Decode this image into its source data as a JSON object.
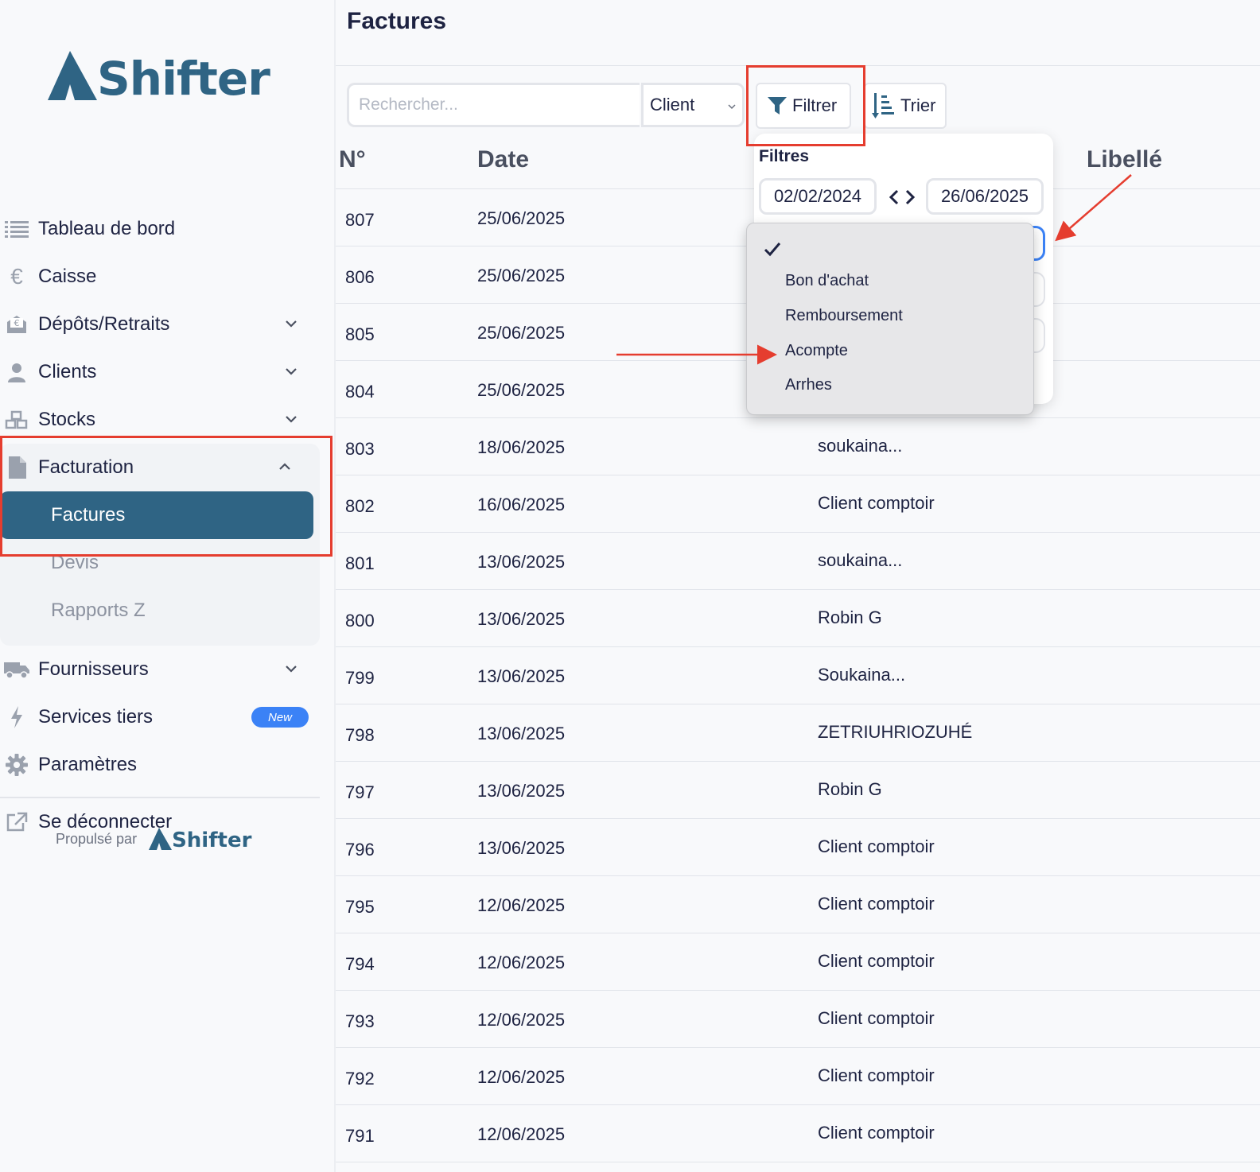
{
  "sidebar": {
    "logo_text": "Shifter",
    "items": [
      {
        "label": "Tableau de bord",
        "icon": "list-icon"
      },
      {
        "label": "Caisse",
        "icon": "euro-icon"
      },
      {
        "label": "Dépôts/Retraits",
        "icon": "envelope-euro-icon"
      },
      {
        "label": "Clients",
        "icon": "user-icon"
      },
      {
        "label": "Stocks",
        "icon": "boxes-icon"
      },
      {
        "label": "Facturation",
        "icon": "file-icon"
      },
      {
        "label": "Fournisseurs",
        "icon": "truck-icon"
      },
      {
        "label": "Services tiers",
        "icon": "bolt-icon",
        "badge": "New"
      },
      {
        "label": "Paramètres",
        "icon": "gear-icon"
      }
    ],
    "sub_items": [
      "Factures",
      "Devis",
      "Rapports Z"
    ],
    "logout_label": "Se déconnecter",
    "powered_by": "Propulsé par",
    "powered_logo": "Shifter"
  },
  "main": {
    "title": "Factures",
    "search_placeholder": "Rechercher...",
    "client_select": "Client",
    "filter_label": "Filtrer",
    "sort_label": "Trier",
    "columns": [
      "N°",
      "Date",
      "Libellé"
    ],
    "rows": [
      {
        "no": "807",
        "date": "25/06/2025",
        "client": ""
      },
      {
        "no": "806",
        "date": "25/06/2025",
        "client": ""
      },
      {
        "no": "805",
        "date": "25/06/2025",
        "client": ""
      },
      {
        "no": "804",
        "date": "25/06/2025",
        "client": ""
      },
      {
        "no": "803",
        "date": "18/06/2025",
        "client": "soukaina..."
      },
      {
        "no": "802",
        "date": "16/06/2025",
        "client": "Client comptoir"
      },
      {
        "no": "801",
        "date": "13/06/2025",
        "client": "soukaina..."
      },
      {
        "no": "800",
        "date": "13/06/2025",
        "client": "Robin G"
      },
      {
        "no": "799",
        "date": "13/06/2025",
        "client": "Soukaina..."
      },
      {
        "no": "798",
        "date": "13/06/2025",
        "client": "ZETRIUHRIOZUHÉ"
      },
      {
        "no": "797",
        "date": "13/06/2025",
        "client": "Robin G"
      },
      {
        "no": "796",
        "date": "13/06/2025",
        "client": "Client comptoir"
      },
      {
        "no": "795",
        "date": "12/06/2025",
        "client": "Client comptoir"
      },
      {
        "no": "794",
        "date": "12/06/2025",
        "client": "Client comptoir"
      },
      {
        "no": "793",
        "date": "12/06/2025",
        "client": "Client comptoir"
      },
      {
        "no": "792",
        "date": "12/06/2025",
        "client": "Client comptoir"
      },
      {
        "no": "791",
        "date": "12/06/2025",
        "client": "Client comptoir"
      }
    ]
  },
  "filter_panel": {
    "title": "Filtres",
    "date_from": "02/02/2024",
    "date_to": "26/06/2025",
    "dropdown_options": [
      "",
      "Bon d'achat",
      "Remboursement",
      "Acompte",
      "Arrhes"
    ],
    "selected_index": 0
  },
  "colors": {
    "brand": "#2f6484",
    "annotation": "#e53d2f",
    "badge": "#3b82f6"
  }
}
